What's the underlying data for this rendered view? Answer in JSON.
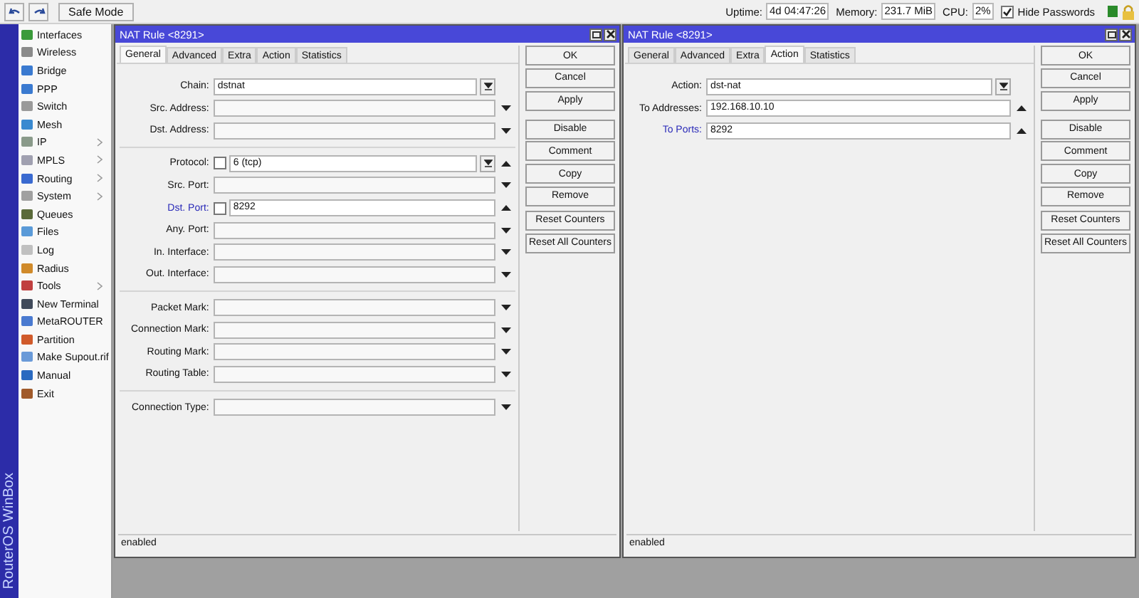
{
  "toolbar": {
    "safe_mode": "Safe Mode",
    "uptime_label": "Uptime:",
    "uptime": "4d 04:47:26",
    "memory_label": "Memory:",
    "memory": "231.7 MiB",
    "cpu_label": "CPU:",
    "cpu": "2%",
    "hide_passwords": {
      "label": "Hide Passwords",
      "checked": true
    }
  },
  "sidebar": {
    "brand": "RouterOS WinBox",
    "items": [
      {
        "label": "Interfaces",
        "submenu": false
      },
      {
        "label": "Wireless",
        "submenu": false
      },
      {
        "label": "Bridge",
        "submenu": false
      },
      {
        "label": "PPP",
        "submenu": false
      },
      {
        "label": "Switch",
        "submenu": false
      },
      {
        "label": "Mesh",
        "submenu": false
      },
      {
        "label": "IP",
        "submenu": true
      },
      {
        "label": "MPLS",
        "submenu": true
      },
      {
        "label": "Routing",
        "submenu": true
      },
      {
        "label": "System",
        "submenu": true
      },
      {
        "label": "Queues",
        "submenu": false
      },
      {
        "label": "Files",
        "submenu": false
      },
      {
        "label": "Log",
        "submenu": false
      },
      {
        "label": "Radius",
        "submenu": false
      },
      {
        "label": "Tools",
        "submenu": true
      },
      {
        "label": "New Terminal",
        "submenu": false
      },
      {
        "label": "MetaROUTER",
        "submenu": false
      },
      {
        "label": "Partition",
        "submenu": false
      },
      {
        "label": "Make Supout.rif",
        "submenu": false
      },
      {
        "label": "Manual",
        "submenu": false
      },
      {
        "label": "Exit",
        "submenu": false
      }
    ]
  },
  "windows": [
    {
      "title": "NAT Rule <8291>",
      "tabs": [
        {
          "label": "General",
          "selected": true
        },
        {
          "label": "Advanced",
          "selected": false
        },
        {
          "label": "Extra",
          "selected": false
        },
        {
          "label": "Action",
          "selected": false
        },
        {
          "label": "Statistics",
          "selected": false
        }
      ],
      "fields": [
        {
          "kind": "field",
          "label": "Chain:",
          "value": "dstnat",
          "dropdown_button": true
        },
        {
          "kind": "field",
          "label": "Src. Address:",
          "expanded": false
        },
        {
          "kind": "field",
          "label": "Dst. Address:",
          "expanded": false
        },
        {
          "kind": "separator"
        },
        {
          "kind": "field",
          "label": "Protocol:",
          "checked": false,
          "value": "6 (tcp)",
          "dropdown_button": true,
          "expanded": true
        },
        {
          "kind": "field",
          "label": "Src. Port:",
          "expanded": false
        },
        {
          "kind": "field",
          "label": "Dst. Port:",
          "accent": true,
          "checked": false,
          "value": "8292",
          "expanded": true
        },
        {
          "kind": "field",
          "label": "Any. Port:",
          "expanded": false
        },
        {
          "kind": "field",
          "label": "In. Interface:",
          "expanded": false
        },
        {
          "kind": "field",
          "label": "Out. Interface:",
          "expanded": false
        },
        {
          "kind": "separator"
        },
        {
          "kind": "field",
          "label": "Packet Mark:",
          "expanded": false
        },
        {
          "kind": "field",
          "label": "Connection Mark:",
          "expanded": false
        },
        {
          "kind": "field",
          "label": "Routing Mark:",
          "expanded": false
        },
        {
          "kind": "field",
          "label": "Routing Table:",
          "expanded": false
        },
        {
          "kind": "separator"
        },
        {
          "kind": "field",
          "label": "Connection Type:",
          "expanded": false
        }
      ],
      "button_groups": [
        [
          "OK",
          "Cancel",
          "Apply"
        ],
        [
          "Disable",
          "Comment",
          "Copy",
          "Remove"
        ],
        [
          "Reset Counters",
          "Reset All Counters"
        ]
      ],
      "status": "enabled"
    },
    {
      "title": "NAT Rule <8291>",
      "tabs": [
        {
          "label": "General",
          "selected": false
        },
        {
          "label": "Advanced",
          "selected": false
        },
        {
          "label": "Extra",
          "selected": false
        },
        {
          "label": "Action",
          "selected": true
        },
        {
          "label": "Statistics",
          "selected": false
        }
      ],
      "fields": [
        {
          "kind": "field",
          "label": "Action:",
          "value": "dst-nat",
          "dropdown_button": true
        },
        {
          "kind": "field",
          "label": "To Addresses:",
          "value": "192.168.10.10",
          "expanded": true
        },
        {
          "kind": "field",
          "label": "To Ports:",
          "accent": true,
          "value": "8292",
          "expanded": true
        }
      ],
      "button_groups": [
        [
          "OK",
          "Cancel",
          "Apply"
        ],
        [
          "Disable",
          "Comment",
          "Copy",
          "Remove"
        ],
        [
          "Reset Counters",
          "Reset All Counters"
        ]
      ],
      "status": "enabled"
    }
  ]
}
